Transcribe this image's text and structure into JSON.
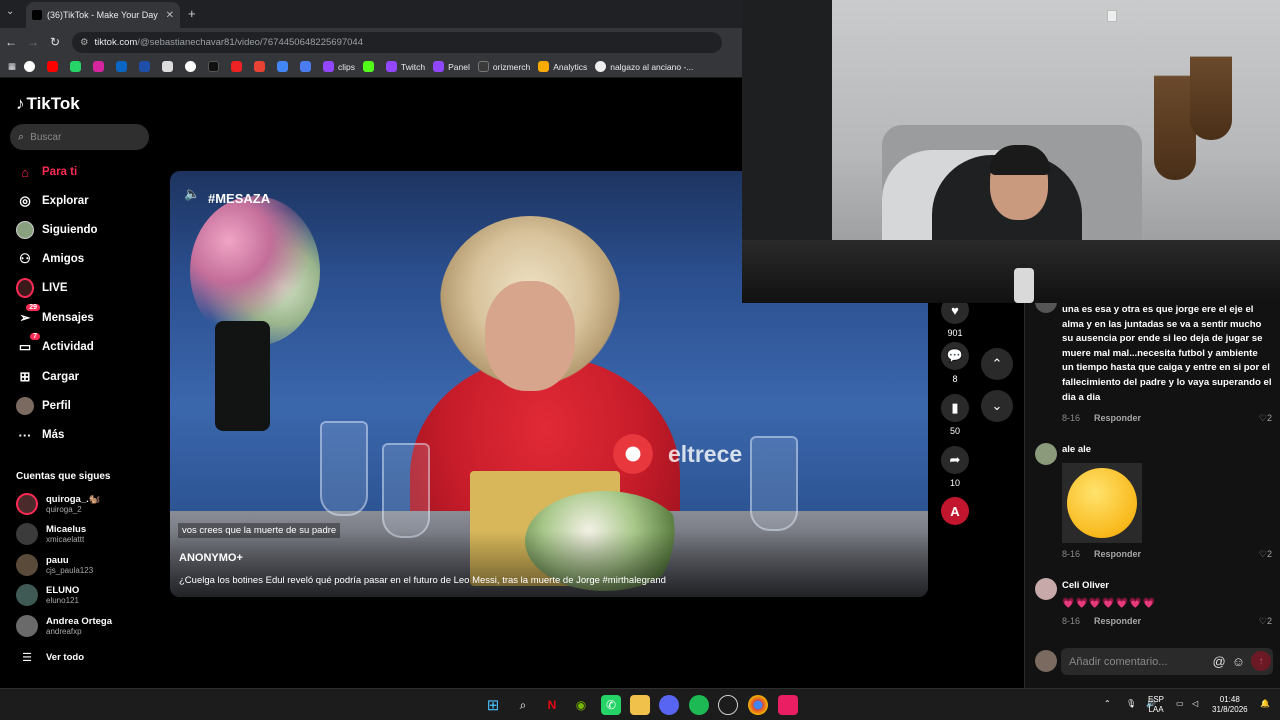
{
  "browser": {
    "tab_title": "(36)TikTok - Make Your Day",
    "url_host": "tiktok.com",
    "url_path": "/@sebastianechavar81/video/7674450648225697044",
    "bookmarks": [
      "clips",
      "Twitch",
      "Panel",
      "orizmerch",
      "Analytics",
      "nalgazo al anciano -..."
    ]
  },
  "sidebar": {
    "logo": "TikTok",
    "search_placeholder": "Buscar",
    "nav": [
      {
        "label": "Para ti",
        "icon": "home-icon",
        "badge": ""
      },
      {
        "label": "Explorar",
        "icon": "compass-icon",
        "badge": ""
      },
      {
        "label": "Siguiendo",
        "icon": "following-avatar-icon",
        "badge": ""
      },
      {
        "label": "Amigos",
        "icon": "friends-icon",
        "badge": ""
      },
      {
        "label": "LIVE",
        "icon": "live-icon",
        "badge": ""
      },
      {
        "label": "Mensajes",
        "icon": "messages-icon",
        "badge": "29"
      },
      {
        "label": "Actividad",
        "icon": "activity-icon",
        "badge": "7"
      },
      {
        "label": "Cargar",
        "icon": "upload-icon",
        "badge": ""
      },
      {
        "label": "Perfil",
        "icon": "profile-avatar-icon",
        "badge": ""
      },
      {
        "label": "Más",
        "icon": "more-icon",
        "badge": ""
      }
    ],
    "following_header": "Cuentas que sigues",
    "following": [
      {
        "name": "quiroga_.🐿️",
        "user": "quiroga_2"
      },
      {
        "name": "Micaelus",
        "user": "xmicaelattt"
      },
      {
        "name": "pauu",
        "user": "cjs_paula123"
      },
      {
        "name": "ELUNO",
        "user": "eluno121"
      },
      {
        "name": "Andrea Ortega",
        "user": "andreafxp"
      }
    ],
    "see_all": "Ver todo"
  },
  "video": {
    "hashtag_overlay": "#MESAZA",
    "channel_watermark": "eltrece",
    "subtitle": "vos crees que la muerte de su padre",
    "author": "ANONYMO+",
    "description": "¿Cuelga los botines Edul reveló qué podría pasar en el futuro de Leo Messi, tras la muerte de Jorge #mirthalegrand"
  },
  "actions": {
    "likes": "901",
    "comments": "8",
    "saves": "50",
    "shares": "10"
  },
  "comments": {
    "first_text": "una es esa y otra es que jorge ere el eje el alma y en las juntadas se va a sentir mucho su ausencia por ende si leo deja de jugar se muere mal mal...necesita futbol y ambiente un tiempo hasta que caiga y entre en si por el fallecimiento del padre y lo vaya superando el dia a dia",
    "first_date": "8-16",
    "first_likes": "2",
    "second_name": "ale ale",
    "second_date": "8-16",
    "second_likes": "2",
    "third_name": "Celi Oliver",
    "third_text": "💗💗💗💗💗💗💗",
    "third_date": "8-16",
    "third_likes": "2",
    "reply_label": "Responder",
    "composer_placeholder": "Añadir comentario...",
    "mention_symbol": "@"
  },
  "taskbar": {
    "lang_top": "ESP",
    "lang_bottom": "LAA",
    "time": "01:48",
    "date": "31/8/2026"
  },
  "colors": {
    "accent": "#fe2c55",
    "background": "#000000"
  }
}
